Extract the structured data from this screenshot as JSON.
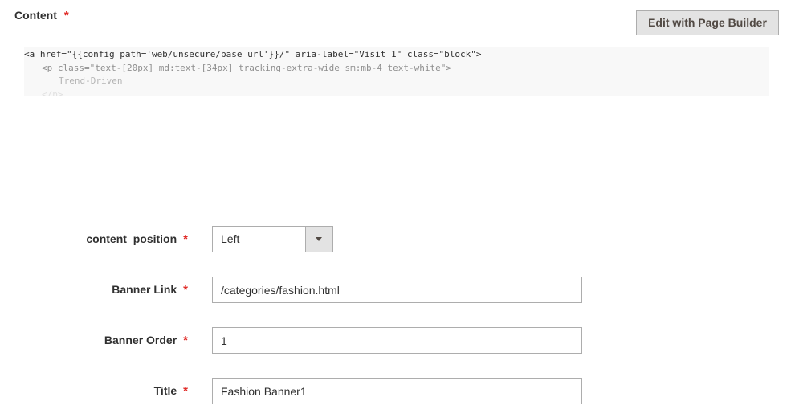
{
  "content": {
    "label": "Content",
    "required_mark": "*",
    "page_builder_button": "Edit with Page Builder",
    "code_lines": [
      "<a href=\"{{config path='web/unsecure/base_url'}}/\" aria-label=\"Visit 1\" class=\"block\">",
      "<p class=\"text-[20px] md:text-[34px] tracking-extra-wide sm:mb-4 text-white\">",
      "Trend-Driven",
      "</p>"
    ]
  },
  "fields": {
    "content_position": {
      "label": "content_position",
      "required_mark": "*",
      "value": "Left"
    },
    "banner_link": {
      "label": "Banner Link",
      "required_mark": "*",
      "value": "/categories/fashion.html"
    },
    "banner_order": {
      "label": "Banner Order",
      "required_mark": "*",
      "value": "1"
    },
    "title": {
      "label": "Title",
      "required_mark": "*",
      "value": "Fashion Banner1"
    }
  },
  "icons": {
    "select_arrow": "chevron-down-icon"
  },
  "colors": {
    "required": "#e02b27",
    "button_bg": "#e3e3e3",
    "input_border": "#adadad",
    "code_bg": "#f8f8f8"
  }
}
